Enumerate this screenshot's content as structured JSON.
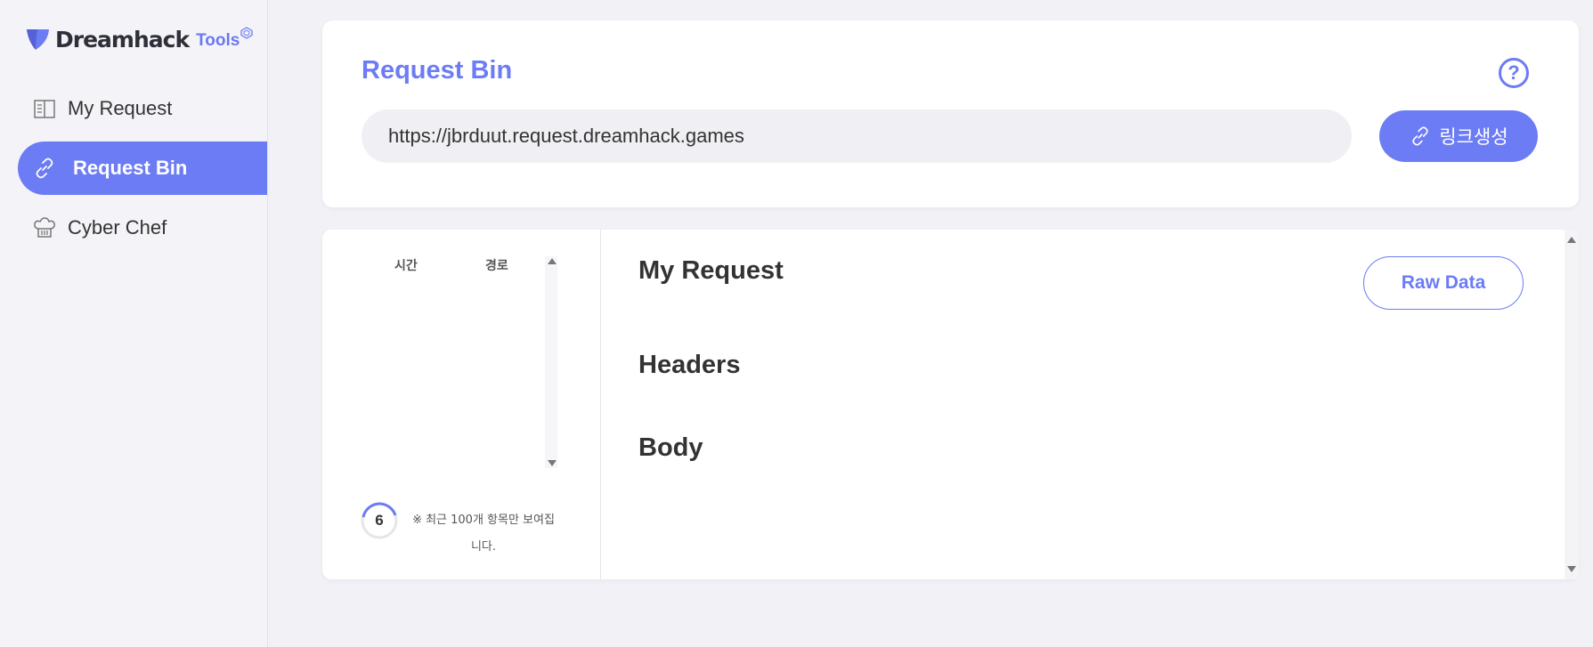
{
  "brand": {
    "name": "Dreamhack",
    "sub": "Tools",
    "accent": "#6c7cf4"
  },
  "sidebar": {
    "items": [
      {
        "label": "My Request",
        "icon": "book-icon",
        "active": false
      },
      {
        "label": "Request Bin",
        "icon": "link-icon",
        "active": true
      },
      {
        "label": "Cyber Chef",
        "icon": "chef-hat-icon",
        "active": false
      }
    ]
  },
  "top": {
    "title": "Request Bin",
    "url_value": "https://jbrduut.request.dreamhack.games",
    "generate_label": "링크생성",
    "help_label": "?"
  },
  "list": {
    "col_time": "시간",
    "col_path": "경로",
    "count": "6",
    "note": "※ 최근 100개 항목만 보여집니다."
  },
  "detail": {
    "title": "My Request",
    "raw_label": "Raw Data",
    "headers_title": "Headers",
    "body_title": "Body"
  }
}
